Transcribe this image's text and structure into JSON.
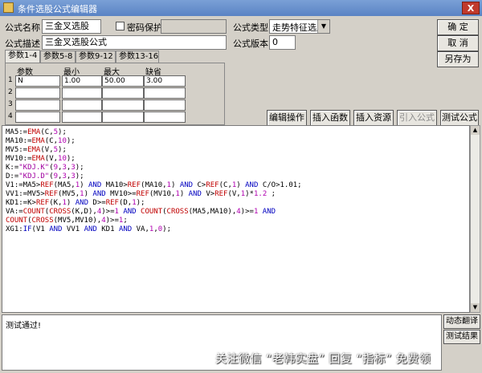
{
  "window": {
    "title": "条件选股公式编辑器",
    "close_label": "X"
  },
  "form": {
    "name_label": "公式名称",
    "name_value": "三金叉选股",
    "password_label": "密码保护",
    "password_value": "",
    "type_label": "公式类型",
    "type_value": "走势特征选股",
    "desc_label": "公式描述",
    "desc_value": "三金叉选股公式",
    "version_label": "公式版本",
    "version_value": "0"
  },
  "buttons": {
    "ok": "确  定",
    "cancel": "取  消",
    "save_as": "另存为",
    "edit_ops": "编辑操作",
    "insert_func": "插入函数",
    "insert_res": "插入资源",
    "import_formula": "引入公式",
    "test_formula": "测试公式",
    "dyn_translate": "动态翻译",
    "test_result": "测试结果"
  },
  "tabs": [
    "参数1-4",
    "参数5-8",
    "参数9-12",
    "参数13-16"
  ],
  "params": {
    "headers": [
      "参数",
      "最小",
      "最大",
      "缺省"
    ],
    "rows": [
      {
        "num": "1",
        "name": "N",
        "min": "1.00",
        "max": "50.00",
        "def": "3.00"
      },
      {
        "num": "2",
        "name": "",
        "min": "",
        "max": "",
        "def": ""
      },
      {
        "num": "3",
        "name": "",
        "min": "",
        "max": "",
        "def": ""
      },
      {
        "num": "4",
        "name": "",
        "min": "",
        "max": "",
        "def": ""
      }
    ]
  },
  "code_lines": [
    "MA5:=EMA(C,5);",
    "MA10:=EMA(C,10);",
    "MV5:=EMA(V,5);",
    "MV10:=EMA(V,10);",
    "K:=\"KDJ.K\"(9,3,3);",
    "D:=\"KDJ.D\"(9,3,3);",
    "V1:=MA5>REF(MA5,1) AND MA10>REF(MA10,1) AND C>REF(C,1) AND C/O>1.01;",
    "VV1:=MV5>REF(MV5,1) AND MV10>=REF(MV10,1) AND V>REF(V,1)*1.2 ;",
    "KD1:=K>REF(K,1) AND D>=REF(D,1);",
    "VA:=COUNT(CROSS(K,D),4)>=1 AND COUNT(CROSS(MA5,MA10),4)>=1 AND",
    "COUNT(CROSS(MV5,MV10),4)>=1;",
    "XG1:IF(V1 AND VV1 AND KD1 AND VA,1,0);"
  ],
  "status": {
    "message": "测试通过!"
  },
  "watermark": "关注微信 “老韩实盘” 回复 “指标” 免费领",
  "icons": {
    "scroll_up": "▲",
    "scroll_down": "▼",
    "dropdown": "▼"
  },
  "colors": {
    "keyword": "#0000c0",
    "function": "#c00000",
    "number": "#b000b0"
  }
}
